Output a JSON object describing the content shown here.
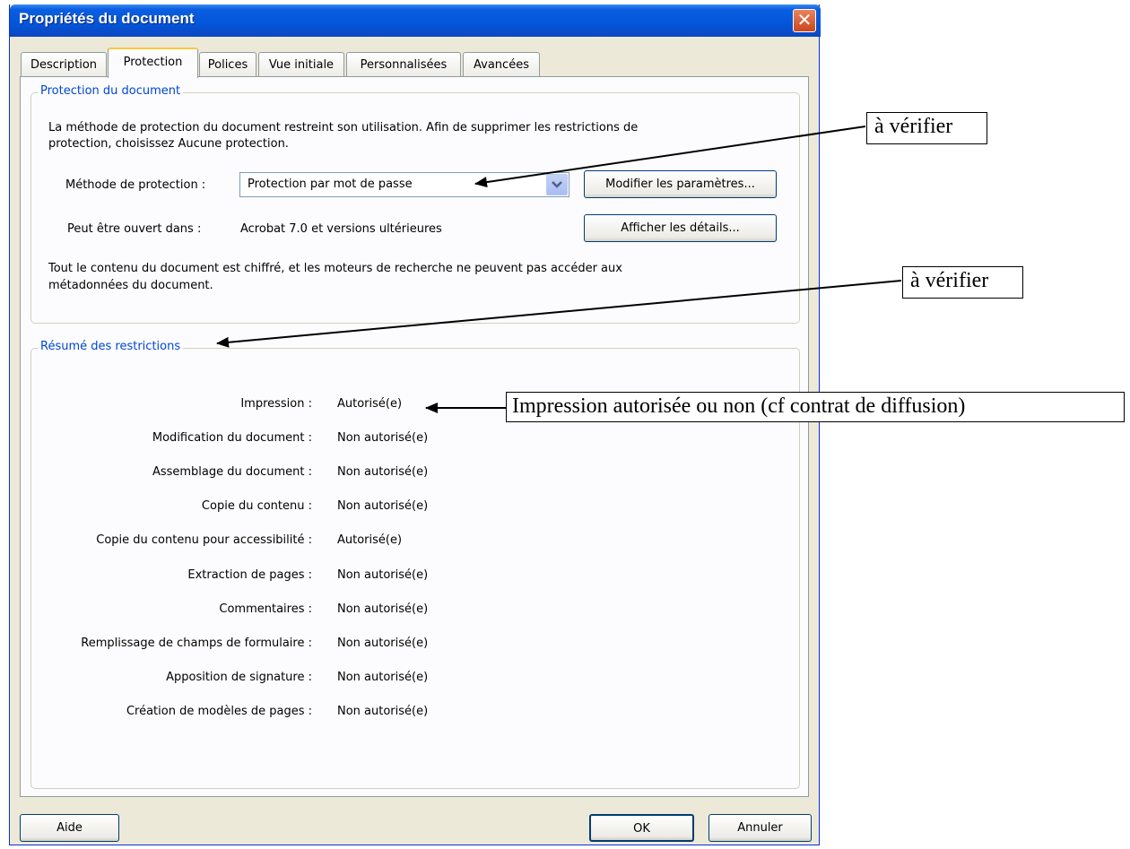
{
  "window": {
    "title": "Propriétés du document",
    "close_glyph": "✕"
  },
  "tabs": [
    {
      "label": "Description"
    },
    {
      "label": "Protection"
    },
    {
      "label": "Polices"
    },
    {
      "label": "Vue initiale"
    },
    {
      "label": "Personnalisées"
    },
    {
      "label": "Avancées"
    }
  ],
  "protection": {
    "group_title": "Protection du document",
    "description_line1": "La méthode de protection du document restreint son utilisation. Afin de supprimer les restrictions de",
    "description_line2": "protection, choisissez Aucune protection.",
    "method_label": "Méthode de protection :",
    "method_value": "Protection par mot de passe",
    "modify_button": "Modifier les paramètres...",
    "open_label": "Peut être ouvert dans :",
    "open_value": "Acrobat 7.0 et versions ultérieures",
    "details_button": "Afficher les détails...",
    "info_line1": "Tout le contenu du document est chiffré, et les moteurs de recherche ne peuvent pas accéder aux",
    "info_line2": "métadonnées du document."
  },
  "restrictions": {
    "group_title": "Résumé des restrictions",
    "rows": [
      {
        "label": "Impression :",
        "value": "Autorisé(e)"
      },
      {
        "label": "Modification du document :",
        "value": "Non autorisé(e)"
      },
      {
        "label": "Assemblage du document :",
        "value": "Non autorisé(e)"
      },
      {
        "label": "Copie du contenu :",
        "value": "Non autorisé(e)"
      },
      {
        "label": "Copie du contenu pour accessibilité :",
        "value": "Autorisé(e)"
      },
      {
        "label": "Extraction de pages :",
        "value": "Non autorisé(e)"
      },
      {
        "label": "Commentaires :",
        "value": "Non autorisé(e)"
      },
      {
        "label": "Remplissage de champs de formulaire :",
        "value": "Non autorisé(e)"
      },
      {
        "label": "Apposition de signature :",
        "value": "Non autorisé(e)"
      },
      {
        "label": "Création de modèles de pages :",
        "value": "Non autorisé(e)"
      }
    ]
  },
  "footer": {
    "help": "Aide",
    "ok": "OK",
    "cancel": "Annuler"
  },
  "annotations": {
    "callout1": "à vérifier",
    "callout2": "à vérifier",
    "callout3": "Impression autorisée ou non (cf contrat de diffusion)"
  },
  "colors": {
    "title_bar": "#0455d9",
    "group_title": "#0046d5",
    "dialog_bg": "#ece9d8"
  }
}
